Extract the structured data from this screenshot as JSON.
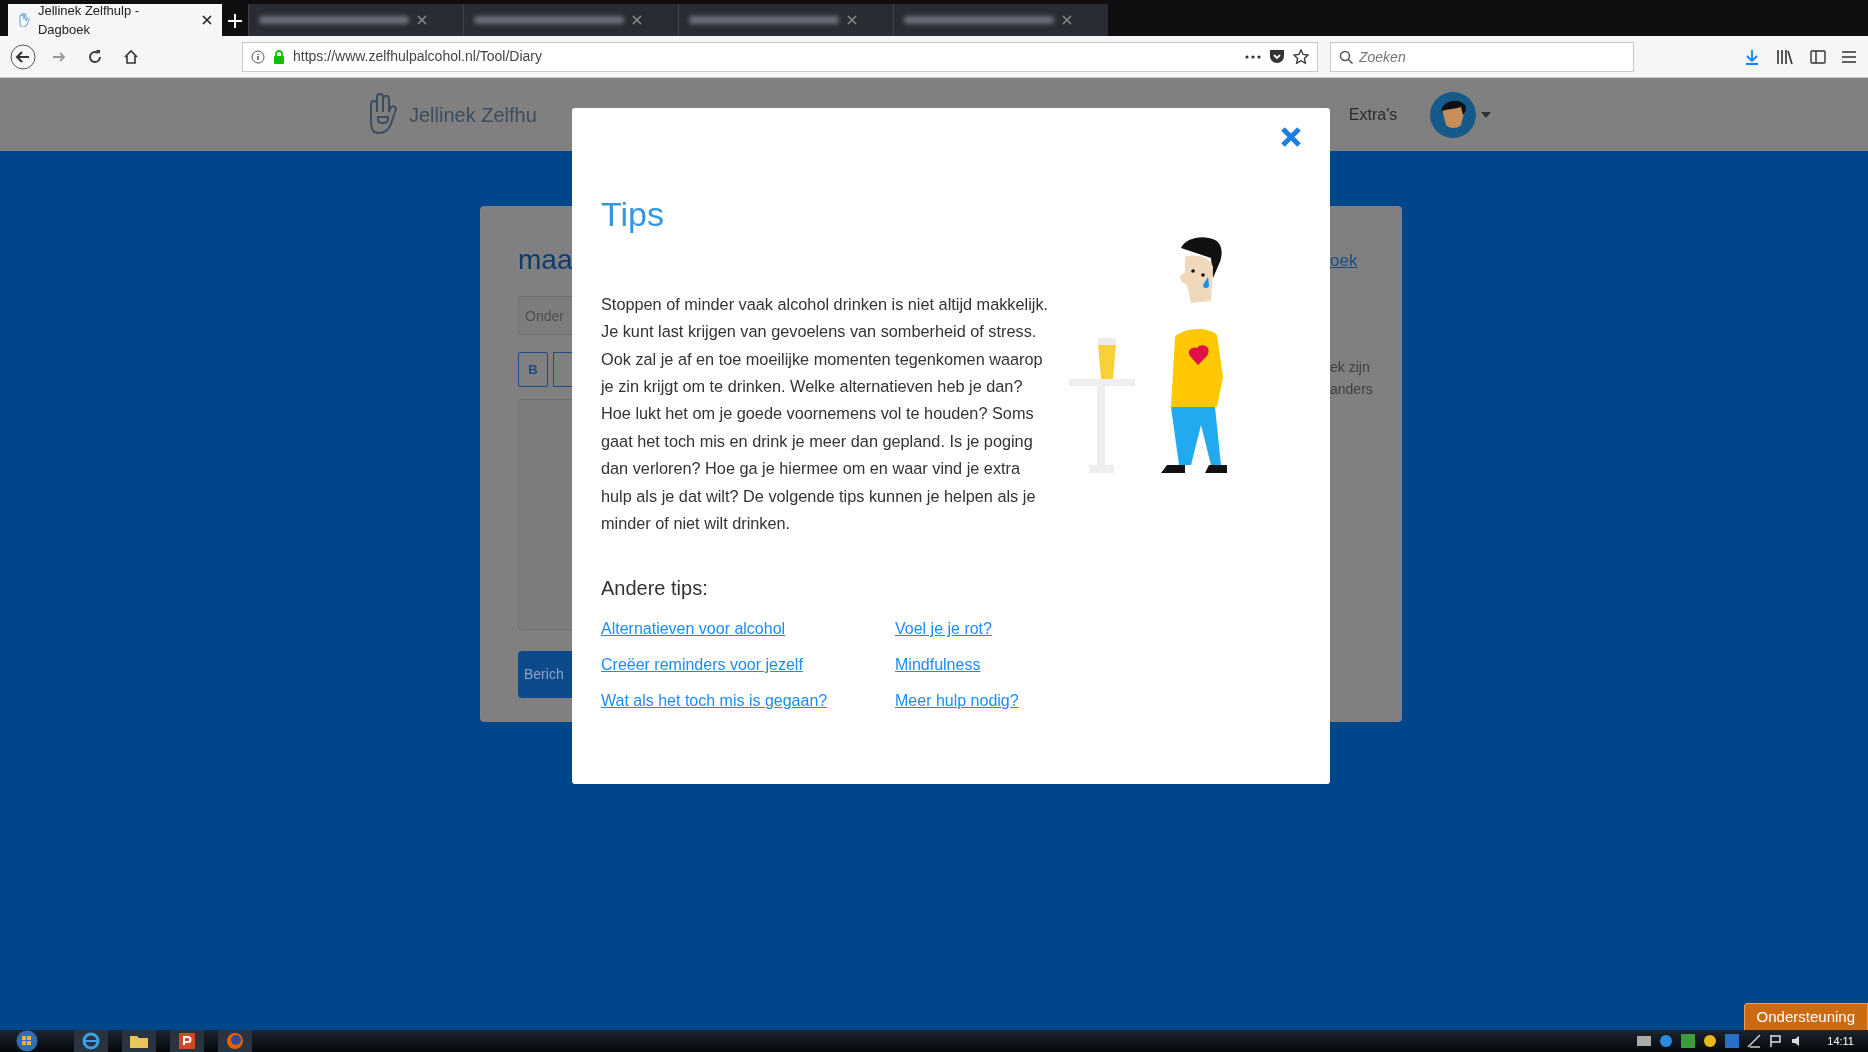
{
  "browser": {
    "tabs": [
      {
        "title": "Jellinek Zelfhulp - Dagboek",
        "selected": true
      },
      {
        "selected": false
      },
      {
        "selected": false
      },
      {
        "selected": false
      },
      {
        "selected": false
      }
    ],
    "url": "https://www.zelfhulpalcohol.nl/Tool/Diary",
    "search": {
      "placeholder": "Zoeken"
    }
  },
  "site_header": {
    "brand": "Jellinek Zelfhu",
    "nav": [
      "Extra's"
    ]
  },
  "diary_card": {
    "title": "maa",
    "subject": {
      "placeholder": "Onder"
    },
    "format_buttons": [
      "B"
    ],
    "submit": "Berich",
    "side_link": "oek",
    "side_text": [
      "ek zijn",
      "anders"
    ]
  },
  "modal": {
    "title": "Tips",
    "body": "Stoppen of minder vaak alcohol drinken is niet altijd makkelijk. Je kunt last krijgen van gevoelens van somberheid of stress. Ook zal je af en toe moeilijke momenten tegenkomen waarop je zin krijgt om te drinken. Welke alternatieven heb je dan? Hoe lukt het om je goede voornemens vol te houden? Soms gaat het toch mis en drink je meer dan gepland. Is je poging dan verloren? Hoe ga je hiermee om en waar vind je extra hulp als je dat wilt? De volgende tips kunnen je helpen als je minder of niet wilt drinken.",
    "section_title": "Andere tips:",
    "links": [
      "Alternatieven voor alcohol",
      "Voel je je rot?",
      "Creëer reminders voor jezelf",
      "Mindfulness",
      "Wat als het toch mis is gegaan?",
      "Meer hulp nodig?"
    ]
  },
  "support_button": "Ondersteuning",
  "taskbar": {
    "clock": "14:11"
  }
}
